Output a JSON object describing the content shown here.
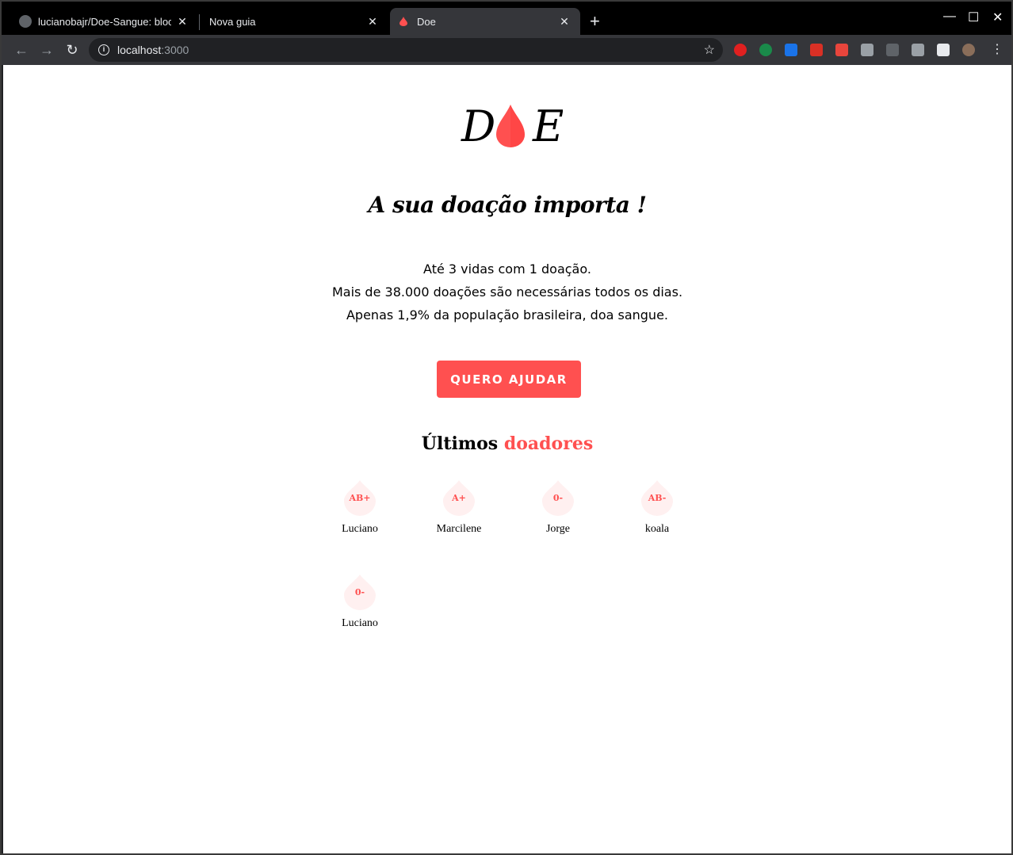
{
  "browser": {
    "tabs": [
      {
        "title": "lucianobajr/Doe-Sangue: bloc",
        "close": "✕"
      },
      {
        "title": "Nova guia",
        "close": "✕"
      },
      {
        "title": "Doe",
        "close": "✕"
      }
    ],
    "new_tab": "+",
    "window_controls": {
      "minimize": "—",
      "maximize": "☐",
      "close": "✕"
    },
    "nav": {
      "back": "←",
      "forward": "→",
      "reload": "↻"
    },
    "address": {
      "host": "localhost",
      "port": ":3000",
      "info": "i"
    },
    "bookmark_icon": "☆",
    "menu_icon": "⋮",
    "extension_colors": [
      "#e02020",
      "#1a8a4a",
      "#1a73e8",
      "#d93025",
      "#e8453c",
      "#9aa0a6",
      "#5f6368",
      "#9aa0a6",
      "#e8eaed"
    ]
  },
  "page": {
    "logo_left": "D",
    "logo_right": "E",
    "headline": "A sua doação importa !",
    "stats": [
      "Até 3 vidas com 1 doação.",
      "Mais de 38.000 doações são necessárias todos os dias.",
      "Apenas 1,9% da população brasileira, doa sangue."
    ],
    "cta": "QUERO AJUDAR",
    "donors_title": {
      "prefix": "Últimos",
      "accent": "doadores"
    },
    "donors": [
      {
        "blood": "AB+",
        "name": "Luciano"
      },
      {
        "blood": "A+",
        "name": "Marcilene"
      },
      {
        "blood": "0-",
        "name": "Jorge"
      },
      {
        "blood": "AB-",
        "name": "koala"
      },
      {
        "blood": "0-",
        "name": "Luciano"
      }
    ],
    "accent_color": "#ff5050"
  }
}
